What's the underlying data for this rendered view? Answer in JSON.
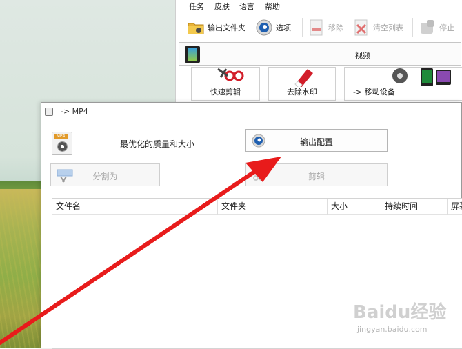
{
  "main_window": {
    "menu": [
      "任务",
      "皮肤",
      "语言",
      "帮助"
    ],
    "toolbar": {
      "output_folder": "输出文件夹",
      "options": "选项",
      "remove": "移除",
      "clear_list": "清空列表",
      "stop": "停止"
    },
    "category": "视频",
    "tiles": [
      "快速剪辑",
      "去除水印",
      "-> 移动设备"
    ]
  },
  "dialog": {
    "title": "-> MP4",
    "format_tag": "MP4",
    "quality_label": "最优化的质量和大小",
    "buttons": {
      "output_config": "输出配置",
      "split": "分割为",
      "edit": "剪辑"
    },
    "table_columns": [
      "文件名",
      "文件夹",
      "大小",
      "持续时间",
      "屏幕"
    ]
  },
  "watermark": {
    "logo": "Baidu经验",
    "url": "jingyan.baidu.com"
  },
  "colors": {
    "annotation_arrow": "#e81b1b",
    "accent_blue": "#1f5fb0"
  }
}
